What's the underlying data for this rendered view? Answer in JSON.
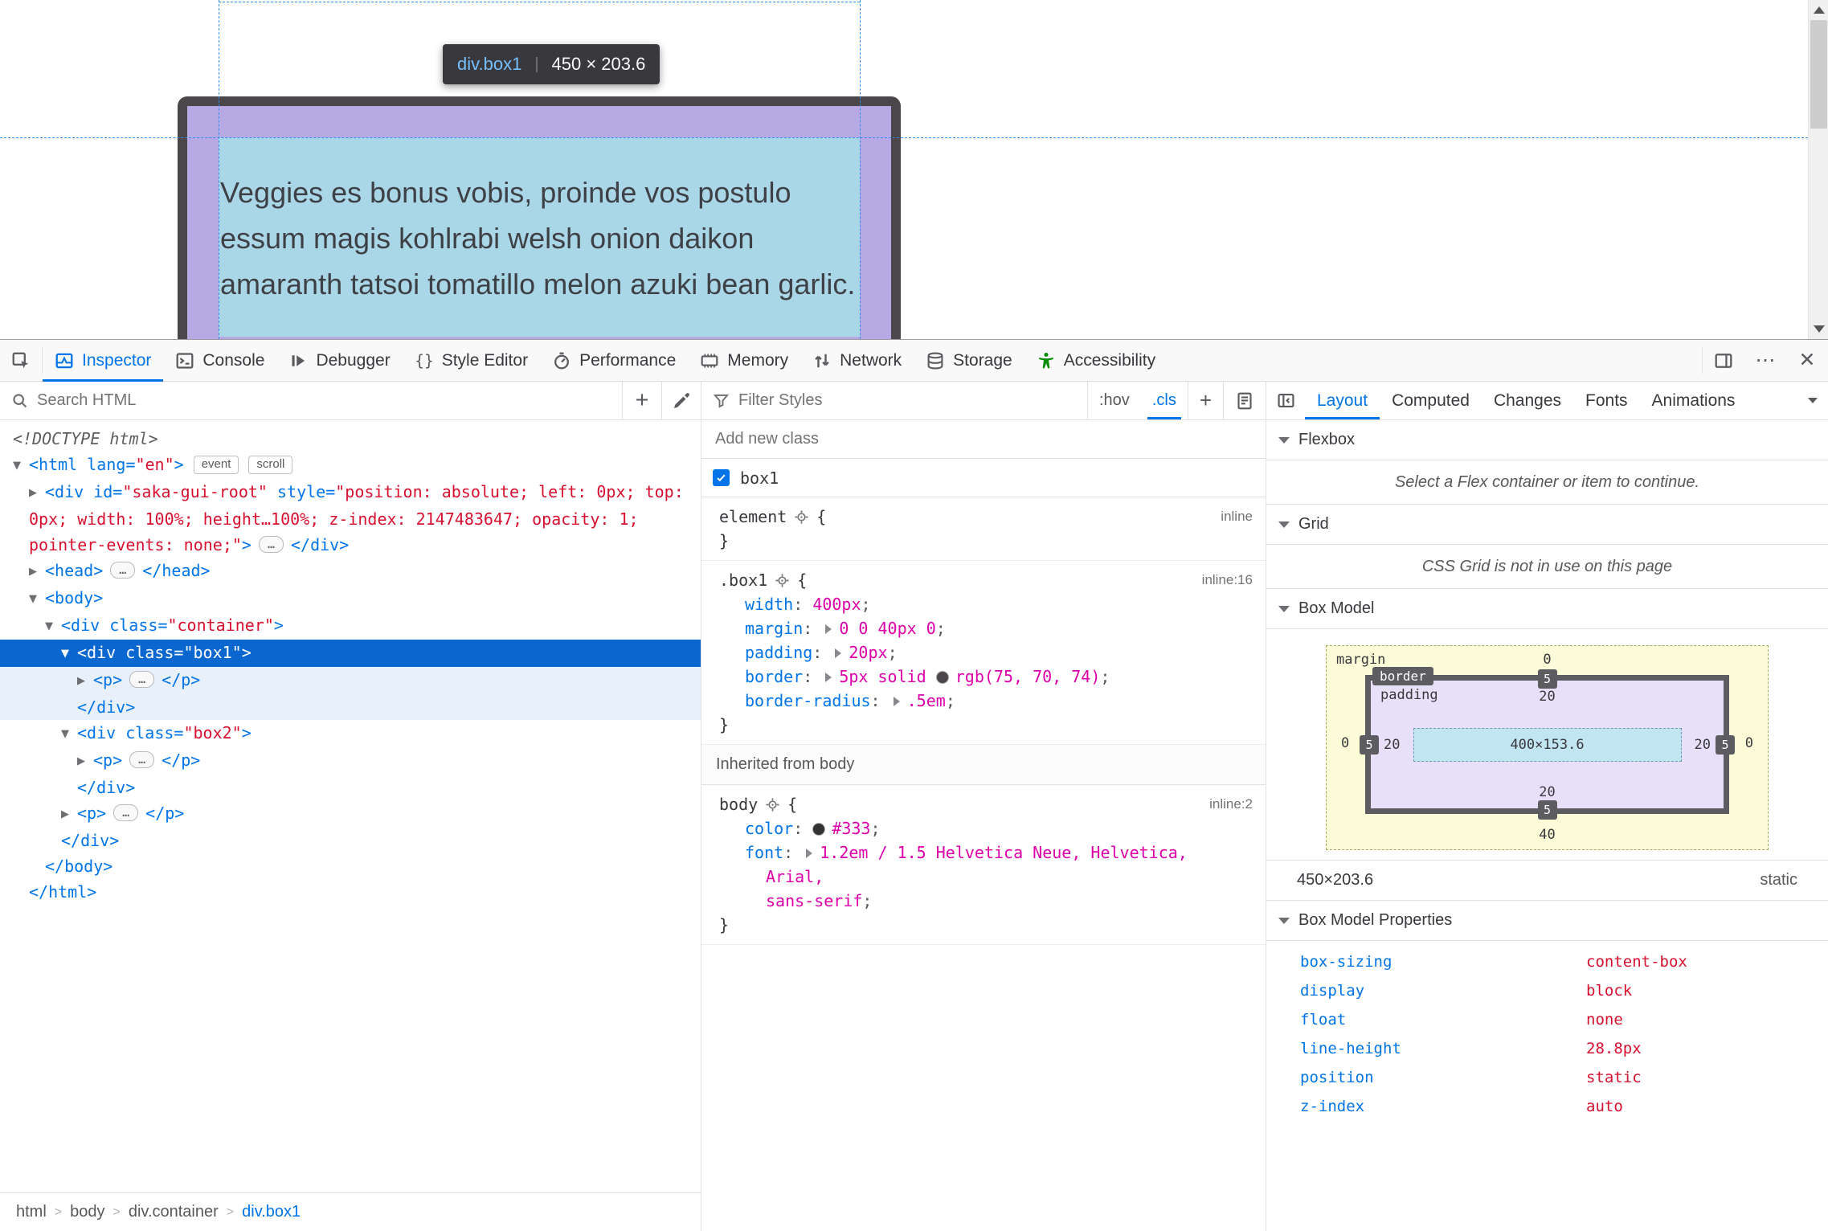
{
  "colors": {
    "accent_blue": "#0074e8",
    "selection_blue": "#0b67d0",
    "attr_value_red": "#d7102f",
    "css_value_magenta": "#dd00a9",
    "accessibility_green": "#058b00",
    "element_border": "#4b464a",
    "highlight_padding_purple": "#b7aae4",
    "highlight_content_blue": "#a9d7e8",
    "boxmodel_margin_yellow": "#fbfbd8",
    "boxmodel_padding_purple": "#e8e0f9",
    "boxmodel_content_blue": "#c2e5f2",
    "boxmodel_border_gray": "#5c5c61"
  },
  "viewport": {
    "tooltip": {
      "selector": "div.box1",
      "separator": "|",
      "size": "450 × 203.6"
    },
    "box_text": "Veggies es bonus vobis, proinde vos postulo essum magis kohlrabi welsh onion daikon amaranth tatsoi tomatillo melon azuki bean garlic."
  },
  "toolbar": {
    "tabs": [
      {
        "id": "inspector",
        "label": "Inspector",
        "active": true
      },
      {
        "id": "console",
        "label": "Console"
      },
      {
        "id": "debugger",
        "label": "Debugger"
      },
      {
        "id": "style-editor",
        "label": "Style Editor"
      },
      {
        "id": "performance",
        "label": "Performance"
      },
      {
        "id": "memory",
        "label": "Memory"
      },
      {
        "id": "network",
        "label": "Network"
      },
      {
        "id": "storage",
        "label": "Storage"
      },
      {
        "id": "accessibility",
        "label": "Accessibility",
        "icon_color": "#058b00"
      }
    ],
    "more_glyph": "⋯",
    "close_glyph": "✕"
  },
  "markup_panel": {
    "search_placeholder": "Search HTML",
    "add_glyph": "+",
    "tree": [
      {
        "kind": "doctype",
        "level": 0,
        "text": "<!DOCTYPE html>"
      },
      {
        "kind": "node",
        "level": 0,
        "arrow": "expanded",
        "parts": [
          [
            "tag",
            "<html"
          ],
          [
            "attr",
            " lang="
          ],
          [
            "val",
            "\"en\""
          ],
          [
            "tag",
            ">"
          ]
        ],
        "badges": [
          "event",
          "scroll"
        ]
      },
      {
        "kind": "node",
        "level": 1,
        "arrow": "collapsed",
        "wrap": true,
        "parts": [
          [
            "tag",
            "<div"
          ],
          [
            "attr",
            " id="
          ],
          [
            "val",
            "\"saka-gui-root\""
          ],
          [
            "attr",
            " style="
          ],
          [
            "val",
            "\"position: absolute; left: 0px; top: 0px; width: 100%; height…100%; z-index: 2147483647; opacity: 1; pointer-events: none;\""
          ],
          [
            "tag",
            ">"
          ],
          [
            "ell",
            "…"
          ],
          [
            "tag",
            "</div>"
          ]
        ]
      },
      {
        "kind": "node",
        "level": 1,
        "arrow": "collapsed",
        "parts": [
          [
            "tag",
            "<head>"
          ],
          [
            "ell",
            "…"
          ],
          [
            "tag",
            "</head>"
          ]
        ]
      },
      {
        "kind": "node",
        "level": 1,
        "arrow": "expanded",
        "parts": [
          [
            "tag",
            "<body>"
          ]
        ]
      },
      {
        "kind": "node",
        "level": 2,
        "arrow": "expanded",
        "parts": [
          [
            "tag",
            "<div"
          ],
          [
            "attr",
            " class="
          ],
          [
            "val",
            "\"container\""
          ],
          [
            "tag",
            ">"
          ]
        ]
      },
      {
        "kind": "node",
        "level": 3,
        "arrow": "expanded",
        "selected": true,
        "parts": [
          [
            "tag",
            "<div"
          ],
          [
            "attr",
            " class="
          ],
          [
            "val",
            "\"box1\""
          ],
          [
            "tag",
            ">"
          ]
        ]
      },
      {
        "kind": "node",
        "level": 4,
        "arrow": "collapsed",
        "tint": true,
        "parts": [
          [
            "tag",
            "<p>"
          ],
          [
            "ell",
            "…"
          ],
          [
            "tag",
            "</p>"
          ]
        ]
      },
      {
        "kind": "close",
        "level": 3,
        "tint": true,
        "parts": [
          [
            "tag",
            "</div>"
          ]
        ]
      },
      {
        "kind": "node",
        "level": 3,
        "arrow": "expanded",
        "parts": [
          [
            "tag",
            "<div"
          ],
          [
            "attr",
            " class="
          ],
          [
            "val",
            "\"box2\""
          ],
          [
            "tag",
            ">"
          ]
        ]
      },
      {
        "kind": "node",
        "level": 4,
        "arrow": "collapsed",
        "parts": [
          [
            "tag",
            "<p>"
          ],
          [
            "ell",
            "…"
          ],
          [
            "tag",
            "</p>"
          ]
        ]
      },
      {
        "kind": "close",
        "level": 3,
        "parts": [
          [
            "tag",
            "</div>"
          ]
        ]
      },
      {
        "kind": "node",
        "level": 3,
        "arrow": "collapsed",
        "parts": [
          [
            "tag",
            "<p>"
          ],
          [
            "ell",
            "…"
          ],
          [
            "tag",
            "</p>"
          ]
        ]
      },
      {
        "kind": "close",
        "level": 2,
        "parts": [
          [
            "tag",
            "</div>"
          ]
        ]
      },
      {
        "kind": "close",
        "level": 1,
        "parts": [
          [
            "tag",
            "</body>"
          ]
        ]
      },
      {
        "kind": "close",
        "level": 0,
        "parts": [
          [
            "tag",
            "</html>"
          ]
        ]
      }
    ],
    "breadcrumbs": [
      {
        "label": "html"
      },
      {
        "label": "body"
      },
      {
        "label": "div.container"
      },
      {
        "label": "div.box1",
        "selected": true
      }
    ]
  },
  "rules_panel": {
    "filter_placeholder": "Filter Styles",
    "pseudo_toggle": ":hov",
    "class_toggle": ".cls",
    "add_glyph": "+",
    "add_new_class": "Add new class",
    "class_checkbox": {
      "label": "box1",
      "checked": true
    },
    "sections": [
      {
        "rules": [
          {
            "selector": "element",
            "open": "{",
            "close": "}",
            "link": "inline",
            "props": []
          },
          {
            "selector": ".box1",
            "open": "{",
            "close": "}",
            "link": "inline:16",
            "props": [
              {
                "name": "width",
                "value": "400px"
              },
              {
                "name": "margin",
                "value": "0 0 40px 0",
                "expandable": true
              },
              {
                "name": "padding",
                "value": "20px",
                "expandable": true
              },
              {
                "name": "border",
                "value_pre": "5px solid ",
                "swatch": "#4b464a",
                "value": "rgb(75, 70, 74)",
                "expandable": true
              },
              {
                "name": "border-radius",
                "value": ".5em",
                "expandable": true
              }
            ]
          }
        ]
      },
      {
        "heading": "Inherited from body",
        "rules": [
          {
            "selector": "body",
            "open": "{",
            "close": "}",
            "link": "inline:2",
            "props": [
              {
                "name": "color",
                "swatch": "#333333",
                "value": "#333"
              },
              {
                "name": "font",
                "value": "1.2em / 1.5 Helvetica Neue, Helvetica, Arial,",
                "value_cont": "sans-serif",
                "expandable": true
              }
            ]
          }
        ]
      }
    ]
  },
  "layout_panel": {
    "tabs": [
      {
        "label": "Layout",
        "active": true
      },
      {
        "label": "Computed"
      },
      {
        "label": "Changes"
      },
      {
        "label": "Fonts"
      },
      {
        "label": "Animations"
      }
    ],
    "flexbox": {
      "title": "Flexbox",
      "message": "Select a Flex container or item to continue."
    },
    "grid": {
      "title": "Grid",
      "message": "CSS Grid is not in use on this page"
    },
    "box_model": {
      "title": "Box Model",
      "margin_label": "margin",
      "border_label": "border",
      "padding_label": "padding",
      "margin": {
        "top": "0",
        "right": "0",
        "bottom": "40",
        "left": "0"
      },
      "border": {
        "top": "5",
        "right": "5",
        "bottom": "5",
        "left": "5"
      },
      "padding": {
        "top": "20",
        "right": "20",
        "bottom": "20",
        "left": "20"
      },
      "content": "400×153.6",
      "dims": "450×203.6",
      "position": "static"
    },
    "properties": {
      "title": "Box Model Properties",
      "items": [
        {
          "name": "box-sizing",
          "value": "content-box"
        },
        {
          "name": "display",
          "value": "block"
        },
        {
          "name": "float",
          "value": "none"
        },
        {
          "name": "line-height",
          "value": "28.8px"
        },
        {
          "name": "position",
          "value": "static"
        },
        {
          "name": "z-index",
          "value": "auto"
        }
      ]
    }
  }
}
